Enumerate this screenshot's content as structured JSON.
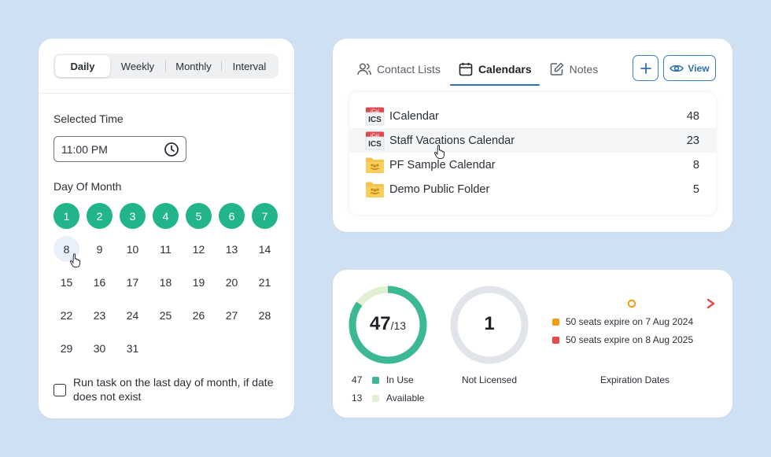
{
  "schedule": {
    "tabs": [
      {
        "label": "Daily",
        "active": true
      },
      {
        "label": "Weekly",
        "active": false
      },
      {
        "label": "Monthly",
        "active": false
      },
      {
        "label": "Interval",
        "active": false
      }
    ],
    "selected_time_label": "Selected Time",
    "time_value": "11:00 PM",
    "day_of_month_label": "Day Of Month",
    "days": [
      "1",
      "2",
      "3",
      "4",
      "5",
      "6",
      "7",
      "8",
      "9",
      "10",
      "11",
      "12",
      "13",
      "14",
      "15",
      "16",
      "17",
      "18",
      "19",
      "20",
      "21",
      "22",
      "23",
      "24",
      "25",
      "26",
      "27",
      "28",
      "29",
      "30",
      "31"
    ],
    "selected_days": [
      "1",
      "2",
      "3",
      "4",
      "5",
      "6",
      "7"
    ],
    "hovered_day": "8",
    "last_day_option": "Run task on the last day of month, if date does not exist",
    "last_day_checked": false,
    "accent_color": "#22b48b"
  },
  "calendars": {
    "tabs": [
      {
        "label": "Contact Lists",
        "icon": "contacts-icon",
        "active": false
      },
      {
        "label": "Calendars",
        "icon": "calendar-icon",
        "active": true
      },
      {
        "label": "Notes",
        "icon": "notes-icon",
        "active": false
      }
    ],
    "add_button_label": "+",
    "view_button_label": "View",
    "ical_badge": "iCal",
    "ics_badge": "ICS",
    "items": [
      {
        "name": "ICalendar",
        "count": "48",
        "icon": "ics-file-icon"
      },
      {
        "name": "Staff Vacations Calendar",
        "count": "23",
        "icon": "ics-file-icon",
        "hovered": true
      },
      {
        "name": "PF Sample Calendar",
        "count": "8",
        "icon": "shared-folder-icon"
      },
      {
        "name": "Demo Public Folder",
        "count": "5",
        "icon": "shared-folder-icon"
      }
    ]
  },
  "licenses": {
    "in_use_ring": {
      "value": "47",
      "total": "/13",
      "fraction": 0.85
    },
    "legend": [
      {
        "num": "47",
        "label": "In Use",
        "color": "#3cb895"
      },
      {
        "num": "13",
        "label": "Available",
        "color": "#e3efd2"
      }
    ],
    "not_licensed_ring": {
      "value": "1"
    },
    "not_licensed_label": "Not Licensed",
    "expirations": [
      {
        "text": "50 seats expire on 7 Aug 2024",
        "color": "#f39c12"
      },
      {
        "text": "50 seats expire on 8 Aug 2025",
        "color": "#e64a4a"
      }
    ],
    "expiration_label": "Expiration Dates",
    "marker_fraction": 0.5
  }
}
